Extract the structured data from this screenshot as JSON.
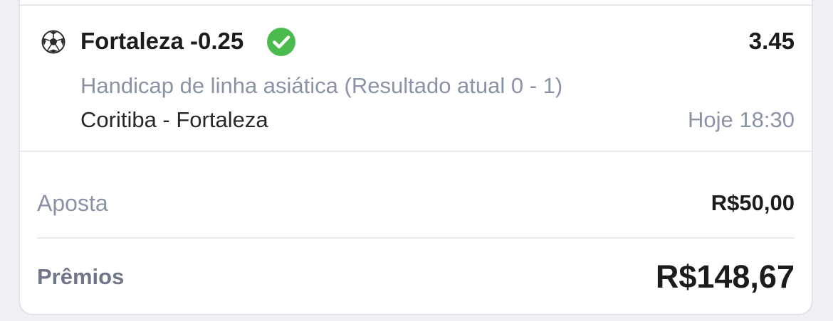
{
  "selection": {
    "sport_icon": "soccer-ball-icon",
    "name": "Fortaleza -0.25",
    "status_icon": "check-circle-icon",
    "status_color": "#4cbb4f",
    "odds": "3.45",
    "market": "Handicap de linha asiática (Resultado atual 0 - 1)",
    "match": "Coritiba - Fortaleza",
    "time": "Hoje 18:30"
  },
  "summary": {
    "stake_label": "Aposta",
    "stake_value": "R$50,00",
    "prize_label": "Prêmios",
    "prize_value": "R$148,67"
  }
}
